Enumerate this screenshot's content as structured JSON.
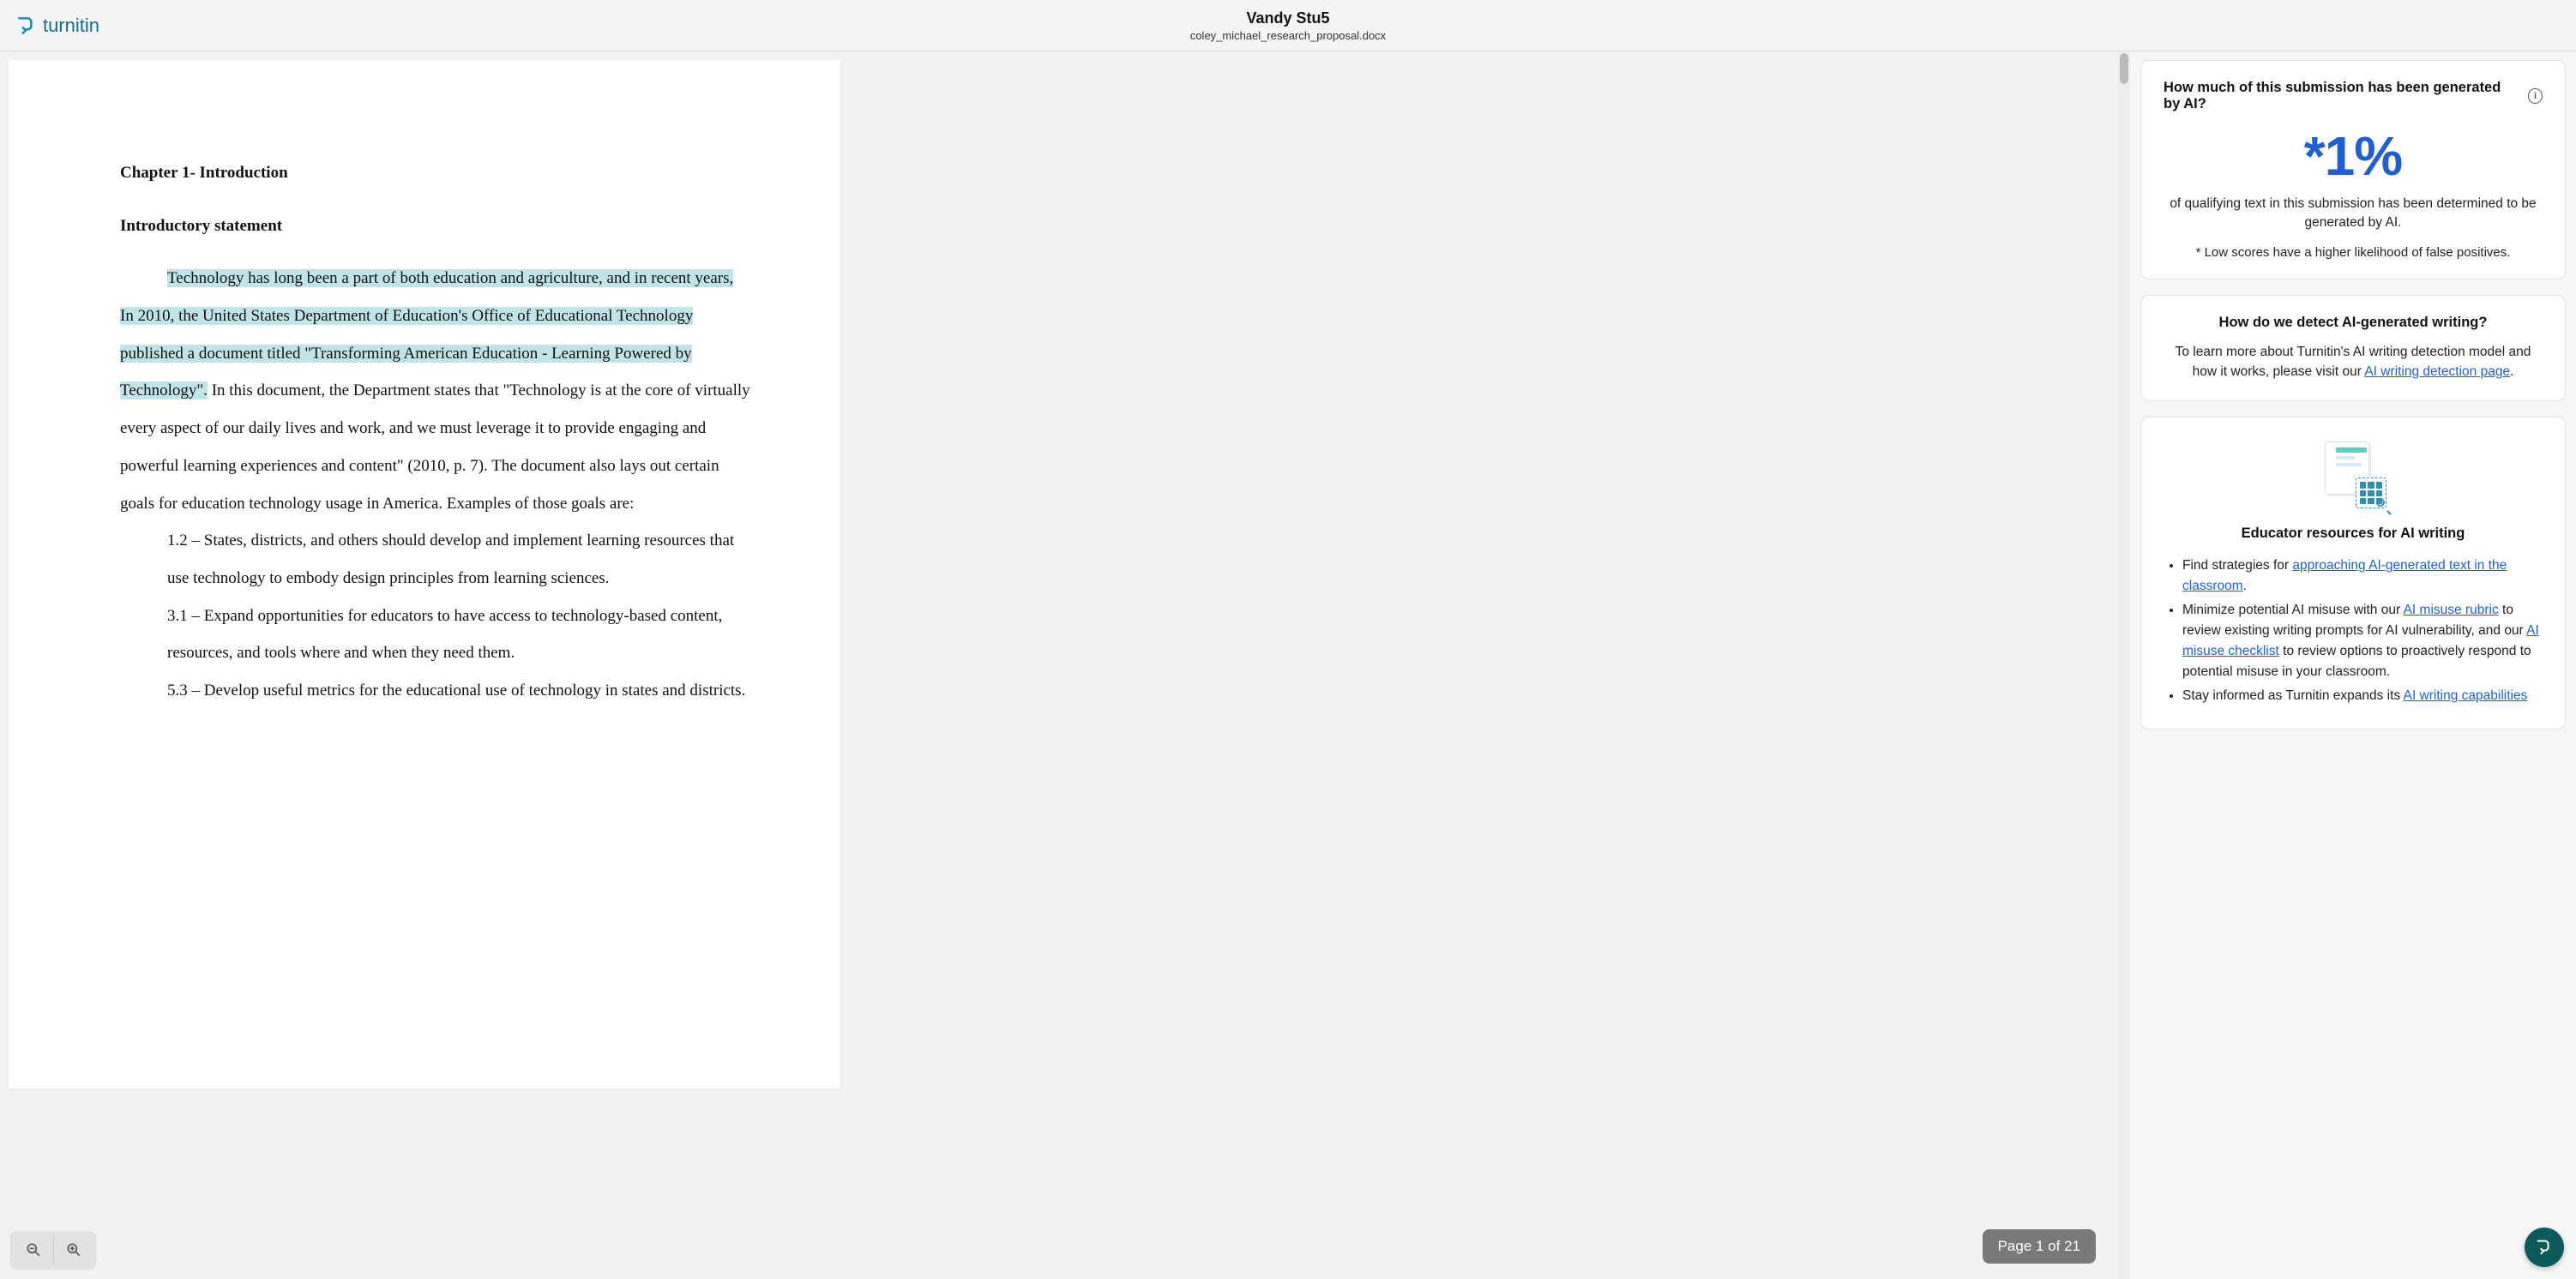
{
  "header": {
    "brand": "turnitin",
    "student_name": "Vandy Stu5",
    "file_name": "coley_michael_research_proposal.docx"
  },
  "document": {
    "chapter_title": "Chapter 1- Introduction",
    "section_title": "Introductory statement",
    "paragraph_hl_1": "Technology has long been a part of both education and agriculture, and in recent years,",
    "paragraph_hl_2": "In 2010, the United States Department of Education's Office of Educational Technology published a document titled \"Transforming American Education - Learning Powered by Technology\".",
    "paragraph_rest": " In this document, the Department states that \"Technology is at the core of virtually every aspect of our daily lives and work, and we must leverage it to provide engaging and powerful learning experiences and content\" (2010, p. 7). The document also lays out certain goals for education technology usage in America. Examples of those goals are:",
    "goal_1": "1.2 – States, districts, and others should develop and implement learning resources that use technology to embody design principles from learning sciences.",
    "goal_2": "3.1 – Expand opportunities for educators to have access to technology-based content, resources, and tools where and when they need them.",
    "goal_3": "5.3 – Develop useful metrics for the educational use of technology in states and districts."
  },
  "page_indicator": "Page 1 of 21",
  "sidebar": {
    "score_card": {
      "title": "How much of this submission has been generated by AI?",
      "score": "*1%",
      "desc": "of qualifying text in this submission has been determined to be generated by AI.",
      "note": "* Low scores have a higher likelihood of false positives."
    },
    "detect_card": {
      "title": "How do we detect AI-generated writing?",
      "body_pre": "To learn more about Turnitin's AI writing detection model and how it works, please visit our ",
      "link_text": "AI writing detection page",
      "body_post": "."
    },
    "educator_card": {
      "title": "Educator resources for AI writing",
      "b1_pre": "Find strategies for ",
      "b1_link": "approaching AI-generated text in the classroom",
      "b1_post": ".",
      "b2_pre": "Minimize potential AI misuse with our ",
      "b2_link1": "AI misuse rubric",
      "b2_mid": " to review existing writing prompts for AI vulnerability, and our ",
      "b2_link2": "AI misuse checklist",
      "b2_post": " to review options to proactively respond to potential misuse in your classroom.",
      "b3_pre": "Stay informed as Turnitin expands its ",
      "b3_link": "AI writing capabilities"
    }
  }
}
